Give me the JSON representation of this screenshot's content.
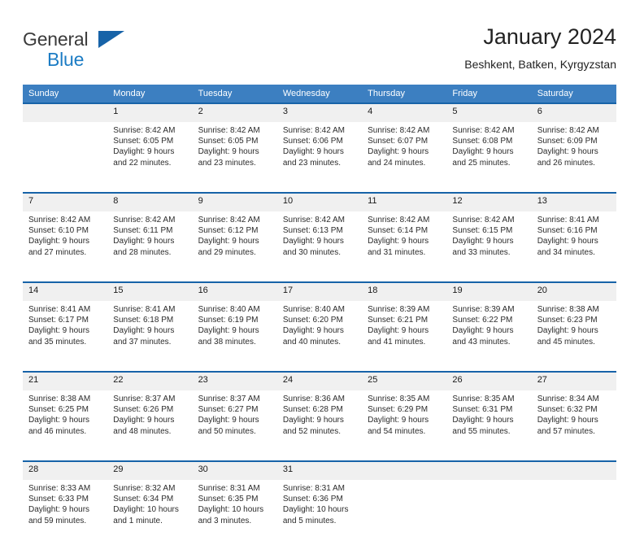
{
  "logo": {
    "text_primary": "General",
    "text_secondary": "Blue",
    "icon": "triangle-icon",
    "primary_color": "#3b3b3b",
    "secondary_color": "#1c7cc4",
    "triangle_color": "#1763a8"
  },
  "header": {
    "title": "January 2024",
    "subtitle": "Beshkent, Batken, Kyrgyzstan"
  },
  "theme": {
    "header_bg": "#3c7fc1",
    "week_separator": "#1763a8",
    "daynum_bg": "#f0f0f0",
    "text": "#2b2b2b"
  },
  "columns": [
    "Sunday",
    "Monday",
    "Tuesday",
    "Wednesday",
    "Thursday",
    "Friday",
    "Saturday"
  ],
  "weeks": [
    {
      "days": [
        {
          "day": "",
          "lines": []
        },
        {
          "day": "1",
          "lines": [
            "Sunrise: 8:42 AM",
            "Sunset: 6:05 PM",
            "Daylight: 9 hours",
            "and 22 minutes."
          ]
        },
        {
          "day": "2",
          "lines": [
            "Sunrise: 8:42 AM",
            "Sunset: 6:05 PM",
            "Daylight: 9 hours",
            "and 23 minutes."
          ]
        },
        {
          "day": "3",
          "lines": [
            "Sunrise: 8:42 AM",
            "Sunset: 6:06 PM",
            "Daylight: 9 hours",
            "and 23 minutes."
          ]
        },
        {
          "day": "4",
          "lines": [
            "Sunrise: 8:42 AM",
            "Sunset: 6:07 PM",
            "Daylight: 9 hours",
            "and 24 minutes."
          ]
        },
        {
          "day": "5",
          "lines": [
            "Sunrise: 8:42 AM",
            "Sunset: 6:08 PM",
            "Daylight: 9 hours",
            "and 25 minutes."
          ]
        },
        {
          "day": "6",
          "lines": [
            "Sunrise: 8:42 AM",
            "Sunset: 6:09 PM",
            "Daylight: 9 hours",
            "and 26 minutes."
          ]
        }
      ]
    },
    {
      "days": [
        {
          "day": "7",
          "lines": [
            "Sunrise: 8:42 AM",
            "Sunset: 6:10 PM",
            "Daylight: 9 hours",
            "and 27 minutes."
          ]
        },
        {
          "day": "8",
          "lines": [
            "Sunrise: 8:42 AM",
            "Sunset: 6:11 PM",
            "Daylight: 9 hours",
            "and 28 minutes."
          ]
        },
        {
          "day": "9",
          "lines": [
            "Sunrise: 8:42 AM",
            "Sunset: 6:12 PM",
            "Daylight: 9 hours",
            "and 29 minutes."
          ]
        },
        {
          "day": "10",
          "lines": [
            "Sunrise: 8:42 AM",
            "Sunset: 6:13 PM",
            "Daylight: 9 hours",
            "and 30 minutes."
          ]
        },
        {
          "day": "11",
          "lines": [
            "Sunrise: 8:42 AM",
            "Sunset: 6:14 PM",
            "Daylight: 9 hours",
            "and 31 minutes."
          ]
        },
        {
          "day": "12",
          "lines": [
            "Sunrise: 8:42 AM",
            "Sunset: 6:15 PM",
            "Daylight: 9 hours",
            "and 33 minutes."
          ]
        },
        {
          "day": "13",
          "lines": [
            "Sunrise: 8:41 AM",
            "Sunset: 6:16 PM",
            "Daylight: 9 hours",
            "and 34 minutes."
          ]
        }
      ]
    },
    {
      "days": [
        {
          "day": "14",
          "lines": [
            "Sunrise: 8:41 AM",
            "Sunset: 6:17 PM",
            "Daylight: 9 hours",
            "and 35 minutes."
          ]
        },
        {
          "day": "15",
          "lines": [
            "Sunrise: 8:41 AM",
            "Sunset: 6:18 PM",
            "Daylight: 9 hours",
            "and 37 minutes."
          ]
        },
        {
          "day": "16",
          "lines": [
            "Sunrise: 8:40 AM",
            "Sunset: 6:19 PM",
            "Daylight: 9 hours",
            "and 38 minutes."
          ]
        },
        {
          "day": "17",
          "lines": [
            "Sunrise: 8:40 AM",
            "Sunset: 6:20 PM",
            "Daylight: 9 hours",
            "and 40 minutes."
          ]
        },
        {
          "day": "18",
          "lines": [
            "Sunrise: 8:39 AM",
            "Sunset: 6:21 PM",
            "Daylight: 9 hours",
            "and 41 minutes."
          ]
        },
        {
          "day": "19",
          "lines": [
            "Sunrise: 8:39 AM",
            "Sunset: 6:22 PM",
            "Daylight: 9 hours",
            "and 43 minutes."
          ]
        },
        {
          "day": "20",
          "lines": [
            "Sunrise: 8:38 AM",
            "Sunset: 6:23 PM",
            "Daylight: 9 hours",
            "and 45 minutes."
          ]
        }
      ]
    },
    {
      "days": [
        {
          "day": "21",
          "lines": [
            "Sunrise: 8:38 AM",
            "Sunset: 6:25 PM",
            "Daylight: 9 hours",
            "and 46 minutes."
          ]
        },
        {
          "day": "22",
          "lines": [
            "Sunrise: 8:37 AM",
            "Sunset: 6:26 PM",
            "Daylight: 9 hours",
            "and 48 minutes."
          ]
        },
        {
          "day": "23",
          "lines": [
            "Sunrise: 8:37 AM",
            "Sunset: 6:27 PM",
            "Daylight: 9 hours",
            "and 50 minutes."
          ]
        },
        {
          "day": "24",
          "lines": [
            "Sunrise: 8:36 AM",
            "Sunset: 6:28 PM",
            "Daylight: 9 hours",
            "and 52 minutes."
          ]
        },
        {
          "day": "25",
          "lines": [
            "Sunrise: 8:35 AM",
            "Sunset: 6:29 PM",
            "Daylight: 9 hours",
            "and 54 minutes."
          ]
        },
        {
          "day": "26",
          "lines": [
            "Sunrise: 8:35 AM",
            "Sunset: 6:31 PM",
            "Daylight: 9 hours",
            "and 55 minutes."
          ]
        },
        {
          "day": "27",
          "lines": [
            "Sunrise: 8:34 AM",
            "Sunset: 6:32 PM",
            "Daylight: 9 hours",
            "and 57 minutes."
          ]
        }
      ]
    },
    {
      "days": [
        {
          "day": "28",
          "lines": [
            "Sunrise: 8:33 AM",
            "Sunset: 6:33 PM",
            "Daylight: 9 hours",
            "and 59 minutes."
          ]
        },
        {
          "day": "29",
          "lines": [
            "Sunrise: 8:32 AM",
            "Sunset: 6:34 PM",
            "Daylight: 10 hours",
            "and 1 minute."
          ]
        },
        {
          "day": "30",
          "lines": [
            "Sunrise: 8:31 AM",
            "Sunset: 6:35 PM",
            "Daylight: 10 hours",
            "and 3 minutes."
          ]
        },
        {
          "day": "31",
          "lines": [
            "Sunrise: 8:31 AM",
            "Sunset: 6:36 PM",
            "Daylight: 10 hours",
            "and 5 minutes."
          ]
        },
        {
          "day": "",
          "lines": []
        },
        {
          "day": "",
          "lines": []
        },
        {
          "day": "",
          "lines": []
        }
      ]
    }
  ]
}
